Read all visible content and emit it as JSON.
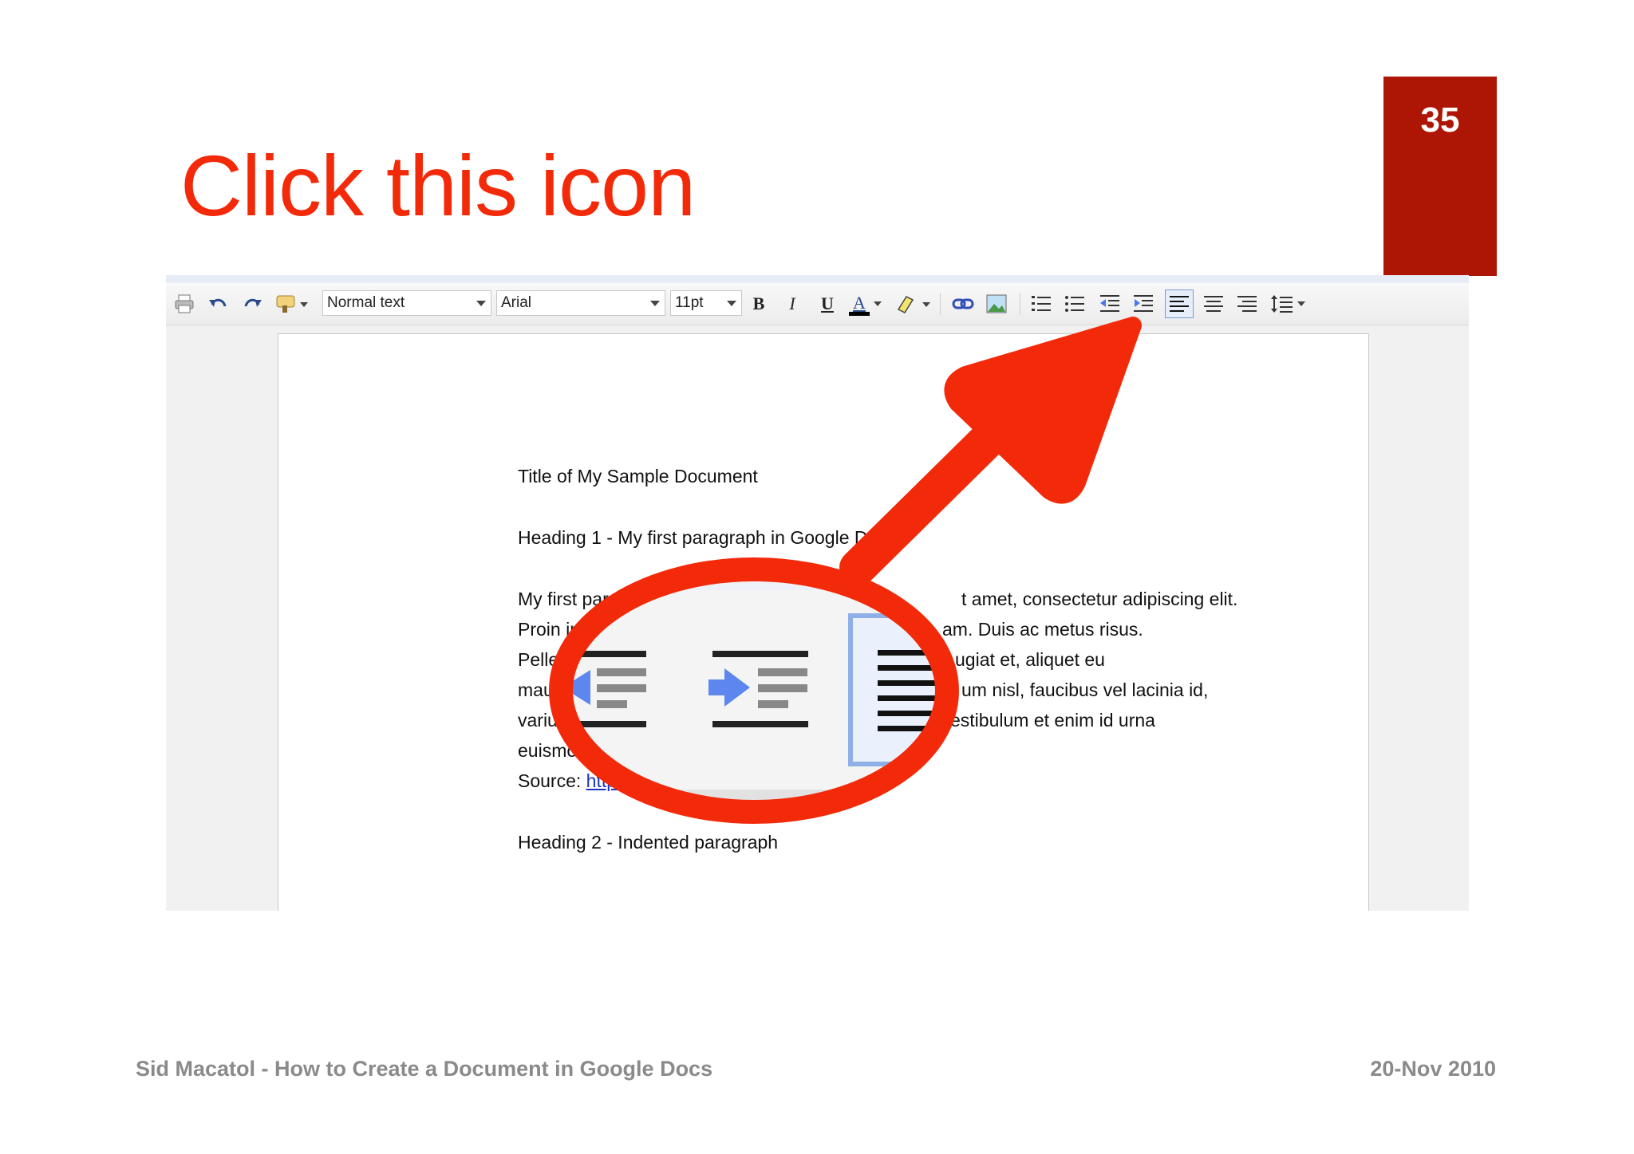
{
  "slide": {
    "number": "35",
    "title": "Click this icon",
    "footer_left": "Sid Macatol - How to Create a Document in Google Docs",
    "footer_right": "20-Nov 2010",
    "accent_color": "#f32a0a",
    "number_box_color": "#ad1604"
  },
  "toolbar": {
    "style_value": "Normal text",
    "font_value": "Arial",
    "size_value": "11pt",
    "bold_label": "B",
    "italic_label": "I",
    "underline_label": "U",
    "text_color_label": "A",
    "icons": [
      "print-icon",
      "undo-icon",
      "redo-icon",
      "paint-format-icon",
      "bold-icon",
      "italic-icon",
      "underline-icon",
      "text-color-icon",
      "highlight-icon",
      "link-icon",
      "image-icon",
      "numbered-list-icon",
      "bulleted-list-icon",
      "decrease-indent-icon",
      "increase-indent-icon",
      "align-left-icon",
      "align-center-icon",
      "align-right-icon",
      "line-spacing-icon"
    ]
  },
  "document": {
    "title_line": "Title of My Sample Document",
    "heading1": "Heading 1 - My first paragraph in Google Docs",
    "p1_start": "My first paragraph in G",
    "p1_end": "t amet, consectetur adipiscing elit.",
    "p2_start": "Proin in arcu nunc",
    "p2_end": "am. Duis ac metus risus.",
    "p3_start": "Pellentesque sit",
    "p3_end": "ugiat et, aliquet eu",
    "p4_start": "mauris.Phasellu",
    "p4_end": "um nisl, faucibus vel lacinia id,",
    "p5_start": "varius nec magn",
    "p5_end": "estibulum et enim id urna",
    "p6": "euismod pulvinar.",
    "source_label": "Source:",
    "source_link": "http://www.lips",
    "heading2": "Heading 2 - Indented paragraph"
  },
  "callout": {
    "zoom_icons": [
      "decrease-indent-icon",
      "increase-indent-icon",
      "align-left-icon"
    ],
    "arrow_color": "#f32a0a"
  }
}
